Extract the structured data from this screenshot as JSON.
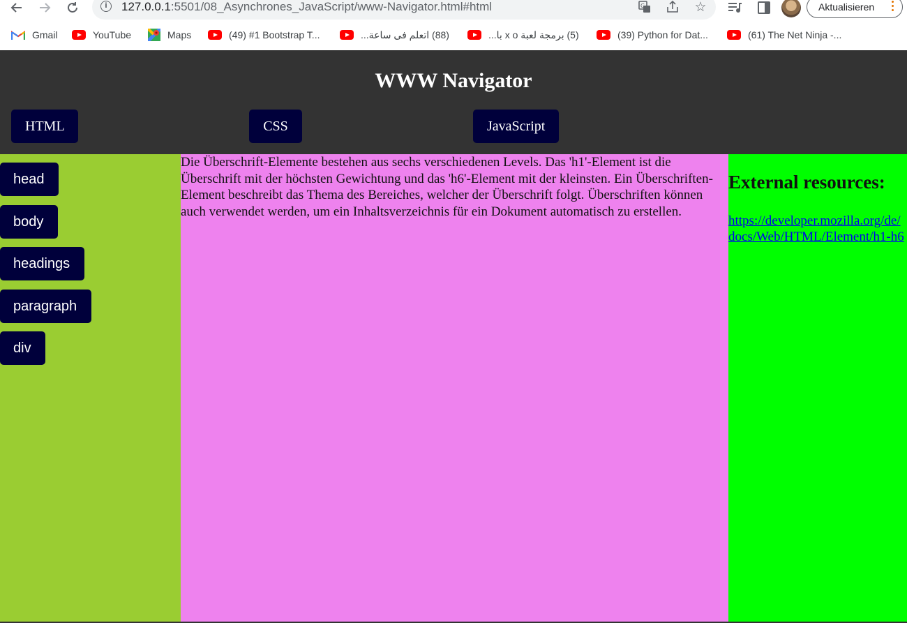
{
  "browser": {
    "url_host": "127.0.0.1",
    "url_path": ":5501/08_Asynchrones_JavaScript/www-Navigator.html#html",
    "update_label": "Aktualisieren",
    "bookmarks": [
      {
        "label": "Gmail",
        "icon": "gmail-icon"
      },
      {
        "label": "YouTube",
        "icon": "youtube-icon"
      },
      {
        "label": "Maps",
        "icon": "maps-icon"
      },
      {
        "label": "(49) #1 Bootstrap T...",
        "icon": "youtube-icon"
      },
      {
        "label": "(88) اتعلم فى ساعة...",
        "icon": "youtube-icon"
      },
      {
        "label": "(5) برمجة لعبة x o با...",
        "icon": "youtube-icon"
      },
      {
        "label": "(39) Python for Dat...",
        "icon": "youtube-icon"
      },
      {
        "label": "(61) The Net Ninja -...",
        "icon": "youtube-icon"
      }
    ]
  },
  "page": {
    "title": "WWW Navigator",
    "top_nav": [
      "HTML",
      "CSS",
      "JavaScript"
    ],
    "side_nav": [
      "head",
      "body",
      "headings",
      "paragraph",
      "div"
    ],
    "content": "Die Überschrift-Elemente bestehen aus sechs verschiedenen Levels. Das 'h1'-Element ist die Überschrift mit der höchsten Gewichtung und das 'h6'-Element mit der kleinsten. Ein Überschriften-Element beschreibt das Thema des Bereiches, welcher der Überschrift folgt. Überschriften können auch verwendet werden, um ein Inhaltsverzeichnis für ein Dokument automatisch zu erstellen.",
    "resources_title": "External resources:",
    "resource_link": "https://developer.mozilla.org/de/docs/Web/HTML/Element/h1-h6"
  },
  "colors": {
    "header_bg": "#333333",
    "button_bg": "#00003b",
    "left_col": "#9acd32",
    "mid_col": "#ee82ee",
    "right_col": "#00ff00"
  }
}
